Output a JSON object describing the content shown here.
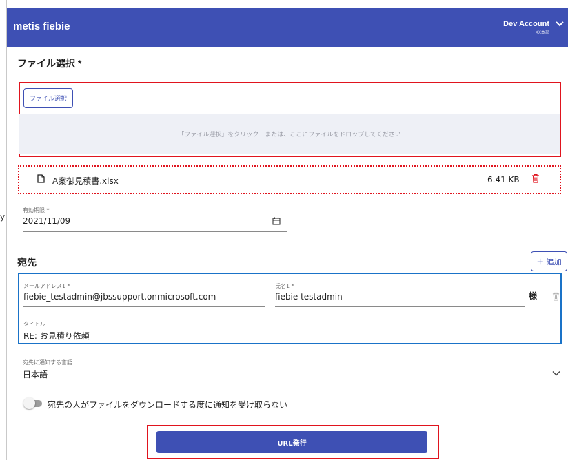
{
  "stray_char": "y",
  "header": {
    "app_name": "metis fiebie",
    "account_name": "Dev Account",
    "account_sub": "XX本部"
  },
  "file_section": {
    "title": "ファイル選択 *",
    "select_button": "ファイル選択",
    "drop_hint": "「ファイル選択」をクリック　または、ここにファイルをドロップしてください",
    "file": {
      "name": "A案御見積書.xlsx",
      "size": "6.41 KB"
    }
  },
  "expiry": {
    "label": "有効期限 *",
    "value": "2021/11/09"
  },
  "recipients": {
    "title": "宛先",
    "add_button": "＋ 追加",
    "email_label": "メールアドレス1 *",
    "email_value": "fiebie_testadmin@jbssupport.onmicrosoft.com",
    "name_label": "氏名1 *",
    "name_value": "fiebie testadmin",
    "honorific": "様",
    "title_label": "タイトル",
    "title_value": "RE: お見積り依頼"
  },
  "language": {
    "label": "宛先に通知する言語",
    "value": "日本語"
  },
  "notify_toggle": {
    "label": "宛先の人がファイルをダウンロードする度に通知を受け取らない",
    "checked": false
  },
  "submit_button": "URL発行",
  "colors": {
    "primary": "#3e50b4",
    "highlight_red": "#e0141e",
    "highlight_blue": "#1a73c8"
  }
}
